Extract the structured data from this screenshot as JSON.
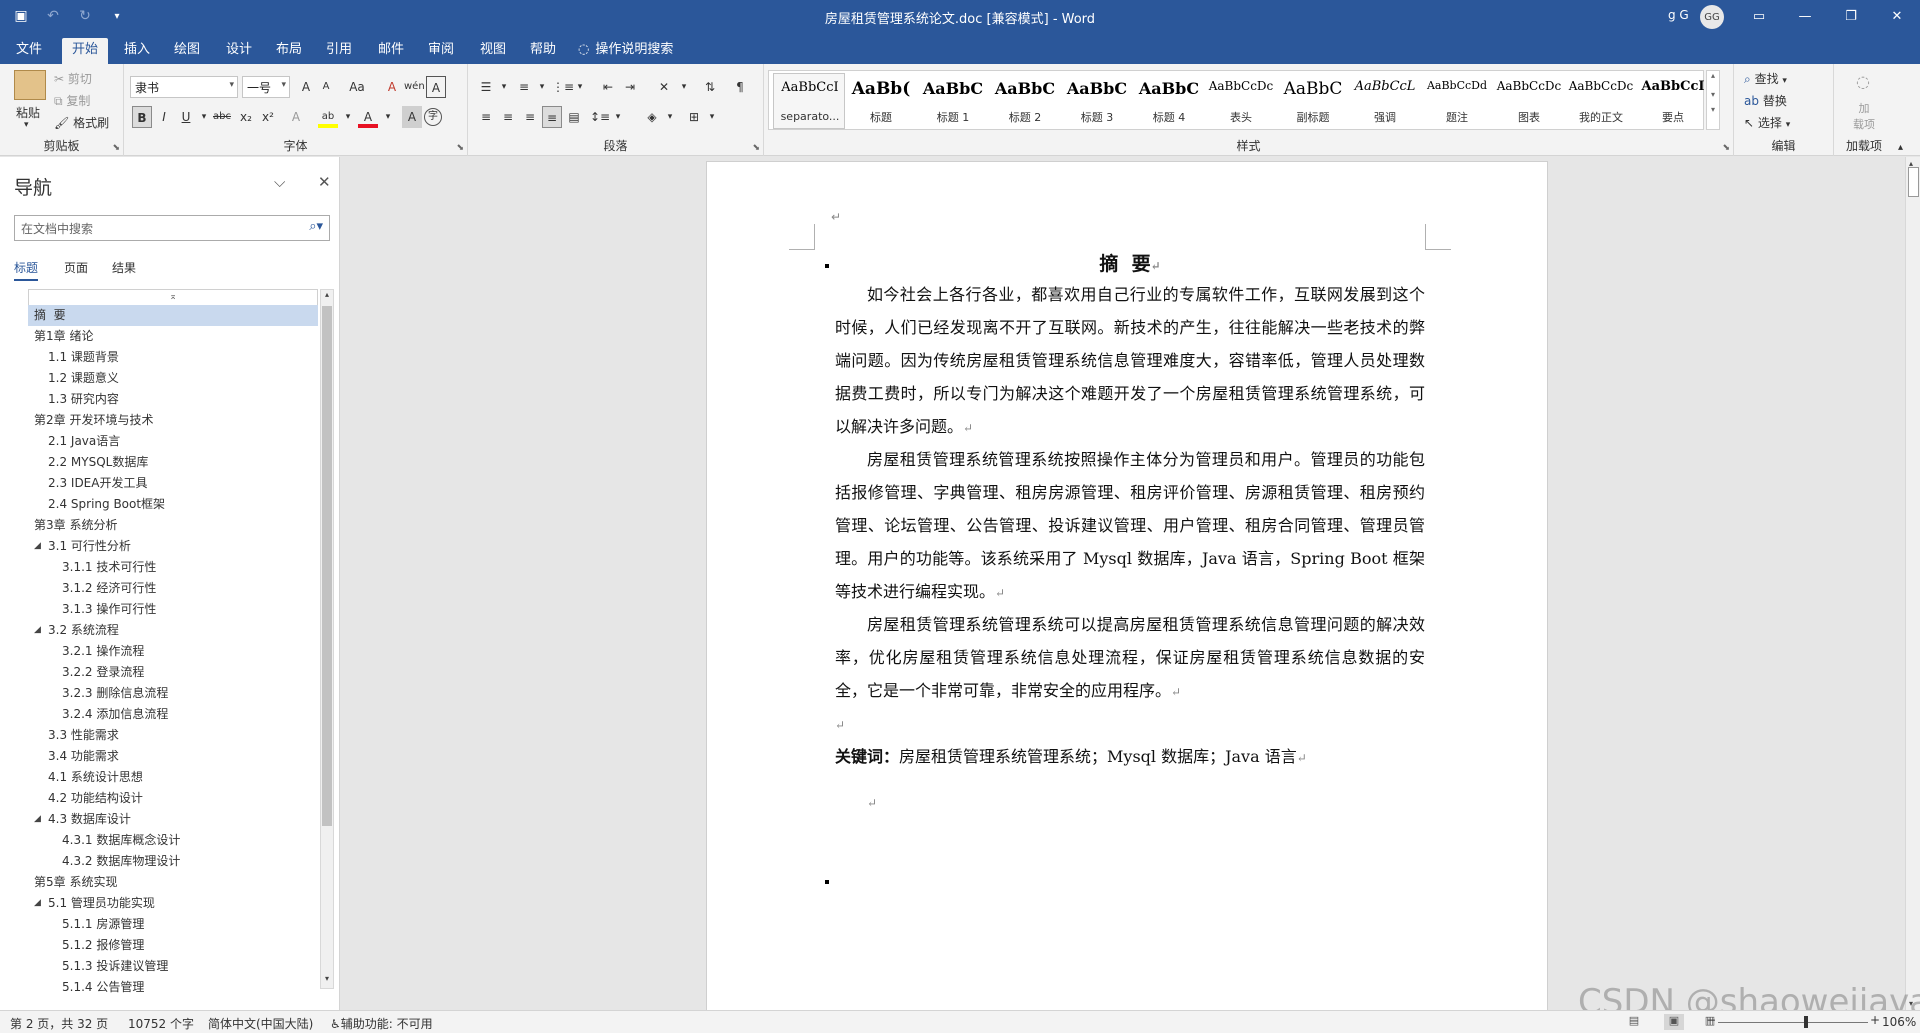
{
  "titlebar": {
    "document_title": "房屋租赁管理系统论文.doc [兼容模式]  -  Word",
    "user_name": "g G",
    "user_initials": "GG",
    "qat": {
      "save_icon": "save-icon",
      "undo_icon": "undo-icon",
      "redo_icon": "redo-icon",
      "customize_icon": "customize-qat-icon"
    },
    "window_buttons": {
      "ribbon_display": "ribbon-display-options-icon",
      "minimize": "minimize-icon",
      "restore": "restore-icon",
      "close": "close-icon"
    }
  },
  "ribbon_tabs": [
    "文件",
    "开始",
    "插入",
    "绘图",
    "设计",
    "布局",
    "引用",
    "邮件",
    "审阅",
    "视图",
    "帮助"
  ],
  "active_tab": "开始",
  "tell_me": "操作说明搜索",
  "ribbon": {
    "clipboard": {
      "label": "剪贴板",
      "paste": "粘贴",
      "cut": "剪切",
      "copy": "复制",
      "format_painter": "格式刷"
    },
    "font": {
      "label": "字体",
      "font_name": "隶书",
      "font_size": "一号",
      "bold": "B",
      "italic": "I",
      "underline": "U",
      "strikethrough": "abc",
      "subscript": "x₂",
      "superscript": "x²",
      "grow": "A",
      "shrink": "A",
      "change_case": "Aa",
      "clear_formatting": "A",
      "phonetic": "wén",
      "char_border": "A",
      "text_effects": "A",
      "highlight": "ab",
      "font_color": "A",
      "char_shading": "A",
      "enclose": "字"
    },
    "paragraph": {
      "label": "段落"
    },
    "styles": {
      "label": "样式",
      "items": [
        {
          "sample": "AaBbCcI",
          "name": "separato...",
          "size": "13px",
          "bold": false
        },
        {
          "sample": "AaBb(",
          "name": "标题",
          "size": "17px",
          "bold": true
        },
        {
          "sample": "AaBbC",
          "name": "标题 1",
          "size": "16px",
          "bold": true
        },
        {
          "sample": "AaBbC",
          "name": "标题 2",
          "size": "16px",
          "bold": true
        },
        {
          "sample": "AaBbC",
          "name": "标题 3",
          "size": "16px",
          "bold": true
        },
        {
          "sample": "AaBbC",
          "name": "标题 4",
          "size": "16px",
          "bold": true
        },
        {
          "sample": "AaBbCcDc",
          "name": "表头",
          "size": "12px",
          "bold": false
        },
        {
          "sample": "AaBbC",
          "name": "副标题",
          "size": "17px",
          "bold": false
        },
        {
          "sample": "AaBbCcL",
          "name": "强调",
          "size": "13px",
          "bold": false,
          "italic": true
        },
        {
          "sample": "AaBbCcDd",
          "name": "题注",
          "size": "11px",
          "bold": false
        },
        {
          "sample": "AaBbCcDc",
          "name": "图表",
          "size": "12px",
          "bold": false
        },
        {
          "sample": "AaBbCcDc",
          "name": "我的正文",
          "size": "12px",
          "bold": false
        },
        {
          "sample": "AaBbCcI",
          "name": "要点",
          "size": "13px",
          "bold": true
        }
      ]
    },
    "editing": {
      "label": "编辑",
      "find": "查找",
      "replace": "替换",
      "select": "选择"
    },
    "addins": {
      "label": "加载项",
      "button": "加\n载项"
    }
  },
  "nav": {
    "title": "导航",
    "search_placeholder": "在文档中搜索",
    "tabs": [
      "标题",
      "页面",
      "结果"
    ],
    "headings": [
      {
        "text": "摘  要",
        "level": 1,
        "selected": true,
        "expand": ""
      },
      {
        "text": "第1章 绪论",
        "level": 1,
        "expand": "◢"
      },
      {
        "text": "1.1 课题背景",
        "level": 2,
        "expand": ""
      },
      {
        "text": "1.2 课题意义",
        "level": 2,
        "expand": ""
      },
      {
        "text": "1.3 研究内容",
        "level": 2,
        "expand": ""
      },
      {
        "text": "第2章 开发环境与技术",
        "level": 1,
        "expand": "◢"
      },
      {
        "text": "2.1 Java语言",
        "level": 2,
        "expand": ""
      },
      {
        "text": "2.2 MYSQL数据库",
        "level": 2,
        "expand": ""
      },
      {
        "text": "2.3 IDEA开发工具",
        "level": 2,
        "expand": ""
      },
      {
        "text": "2.4 Spring Boot框架",
        "level": 2,
        "expand": ""
      },
      {
        "text": "第3章 系统分析",
        "level": 1,
        "expand": "◢"
      },
      {
        "text": "3.1 可行性分析",
        "level": 2,
        "expand": "◢"
      },
      {
        "text": "3.1.1 技术可行性",
        "level": 3,
        "expand": ""
      },
      {
        "text": "3.1.2 经济可行性",
        "level": 3,
        "expand": ""
      },
      {
        "text": "3.1.3 操作可行性",
        "level": 3,
        "expand": ""
      },
      {
        "text": "3.2 系统流程",
        "level": 2,
        "expand": "◢"
      },
      {
        "text": "3.2.1 操作流程",
        "level": 3,
        "expand": ""
      },
      {
        "text": "3.2.2 登录流程",
        "level": 3,
        "expand": ""
      },
      {
        "text": "3.2.3 删除信息流程",
        "level": 3,
        "expand": ""
      },
      {
        "text": "3.2.4 添加信息流程",
        "level": 3,
        "expand": ""
      },
      {
        "text": "3.3 性能需求",
        "level": 2,
        "expand": ""
      },
      {
        "text": "3.4 功能需求",
        "level": 2,
        "expand": ""
      },
      {
        "text": "4.1 系统设计思想",
        "level": 2,
        "expand": ""
      },
      {
        "text": "4.2 功能结构设计",
        "level": 2,
        "expand": ""
      },
      {
        "text": "4.3 数据库设计",
        "level": 2,
        "expand": "◢"
      },
      {
        "text": "4.3.1 数据库概念设计",
        "level": 3,
        "expand": ""
      },
      {
        "text": "4.3.2 数据库物理设计",
        "level": 3,
        "expand": ""
      },
      {
        "text": "第5章 系统实现",
        "level": 1,
        "expand": "◢"
      },
      {
        "text": "5.1 管理员功能实现",
        "level": 2,
        "expand": "◢"
      },
      {
        "text": "5.1.1 房源管理",
        "level": 3,
        "expand": ""
      },
      {
        "text": "5.1.2 报修管理",
        "level": 3,
        "expand": ""
      },
      {
        "text": "5.1.3 投诉建议管理",
        "level": 3,
        "expand": ""
      },
      {
        "text": "5.1.4 公告管理",
        "level": 3,
        "expand": ""
      }
    ]
  },
  "document": {
    "heading": "摘  要",
    "paragraphs": [
      "如今社会上各行各业，都喜欢用自己行业的专属软件工作，互联网发展到这个时候，人们已经发现离不开了互联网。新技术的产生，往往能解决一些老技术的弊端问题。因为传统房屋租赁管理系统信息管理难度大，容错率低，管理人员处理数据费工费时，所以专门为解决这个难题开发了一个房屋租赁管理系统管理系统，可以解决许多问题。",
      "房屋租赁管理系统管理系统按照操作主体分为管理员和用户。管理员的功能包括报修管理、字典管理、租房房源管理、租房评价管理、房源租赁管理、租房预约管理、论坛管理、公告管理、投诉建议管理、用户管理、租房合同管理、管理员管理。用户的功能等。该系统采用了 Mysql 数据库，Java 语言，Spring Boot 框架等技术进行编程实现。",
      "房屋租赁管理系统管理系统可以提高房屋租赁管理系统信息管理问题的解决效率，优化房屋租赁管理系统信息处理流程，保证房屋租赁管理系统信息数据的安全，它是一个非常可靠，非常安全的应用程序。"
    ],
    "keywords_label": "关键词：",
    "keywords": "房屋租赁管理系统管理系统；Mysql 数据库；Java 语言",
    "para_mark": "↵"
  },
  "status": {
    "page": "第 2 页，共 32 页",
    "words": "10752 个字",
    "language": "简体中文(中国大陆)",
    "accessibility": "辅助功能: 不可用",
    "zoom": "106%"
  },
  "watermark": "CSDN @shaoweijava",
  "colors": {
    "accent": "#2b579a",
    "selected_heading": "#c9d9ee",
    "font_color_bar": "#e81123",
    "highlight_bar": "#ffff00"
  }
}
